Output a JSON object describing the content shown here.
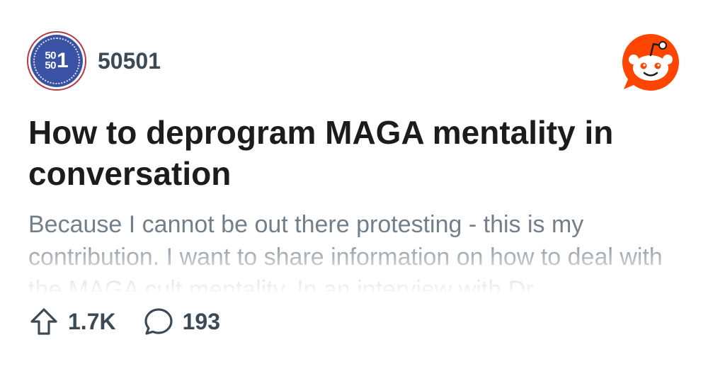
{
  "subreddit": {
    "avatar_top": "50",
    "avatar_bottom": "50",
    "avatar_big": "1",
    "name": "50501"
  },
  "post": {
    "title": "How to deprogram MAGA mentality in conversation",
    "body": "Because I cannot be out there protesting - this is my contribution. I want to share information on how to deal with the MAGA cult mentality. In an interview with Dr."
  },
  "stats": {
    "upvotes": "1.7K",
    "comments": "193"
  },
  "icons": {
    "upvote": "upvote-arrow-icon",
    "comment": "comment-bubble-icon",
    "logo": "reddit-logo-icon"
  },
  "colors": {
    "brand": "#ff4500",
    "avatar_bg": "#3a52a4",
    "avatar_ring": "#b23a48",
    "text_dark": "#1c1c1c",
    "text_muted": "#6e7b86",
    "stat_text": "#3c4a56"
  }
}
